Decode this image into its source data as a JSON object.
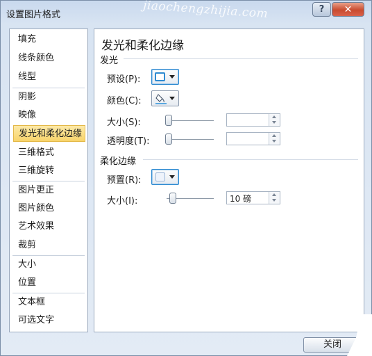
{
  "window": {
    "title": "设置图片格式",
    "watermark": "jiaochengzhijia.com",
    "help_glyph": "?",
    "close_glyph": "✕"
  },
  "sidebar": {
    "items": [
      {
        "label": "填充"
      },
      {
        "label": "线条颜色"
      },
      {
        "label": "线型"
      },
      {
        "label": "阴影"
      },
      {
        "label": "映像"
      },
      {
        "label": "发光和柔化边缘",
        "selected": true
      },
      {
        "label": "三维格式"
      },
      {
        "label": "三维旋转"
      },
      {
        "label": "图片更正"
      },
      {
        "label": "图片颜色"
      },
      {
        "label": "艺术效果"
      },
      {
        "label": "裁剪"
      },
      {
        "label": "大小"
      },
      {
        "label": "位置"
      },
      {
        "label": "文本框"
      },
      {
        "label": "可选文字"
      }
    ]
  },
  "panel": {
    "title": "发光和柔化边缘",
    "glow": {
      "section": "发光",
      "preset_label": "预设(P):",
      "color_label": "颜色(C):",
      "size_label": "大小(S):",
      "size_value": "",
      "transparency_label": "透明度(T):",
      "transparency_value": ""
    },
    "soft_edges": {
      "section": "柔化边缘",
      "preset_label": "预置(R):",
      "size_label": "大小(I):",
      "size_value": "10 磅"
    }
  },
  "footer": {
    "close_label": "关闭"
  },
  "colors": {
    "accent": "#2f8bd1",
    "selected_bg": "#f8d46a",
    "close_button": "#c94b2f"
  }
}
